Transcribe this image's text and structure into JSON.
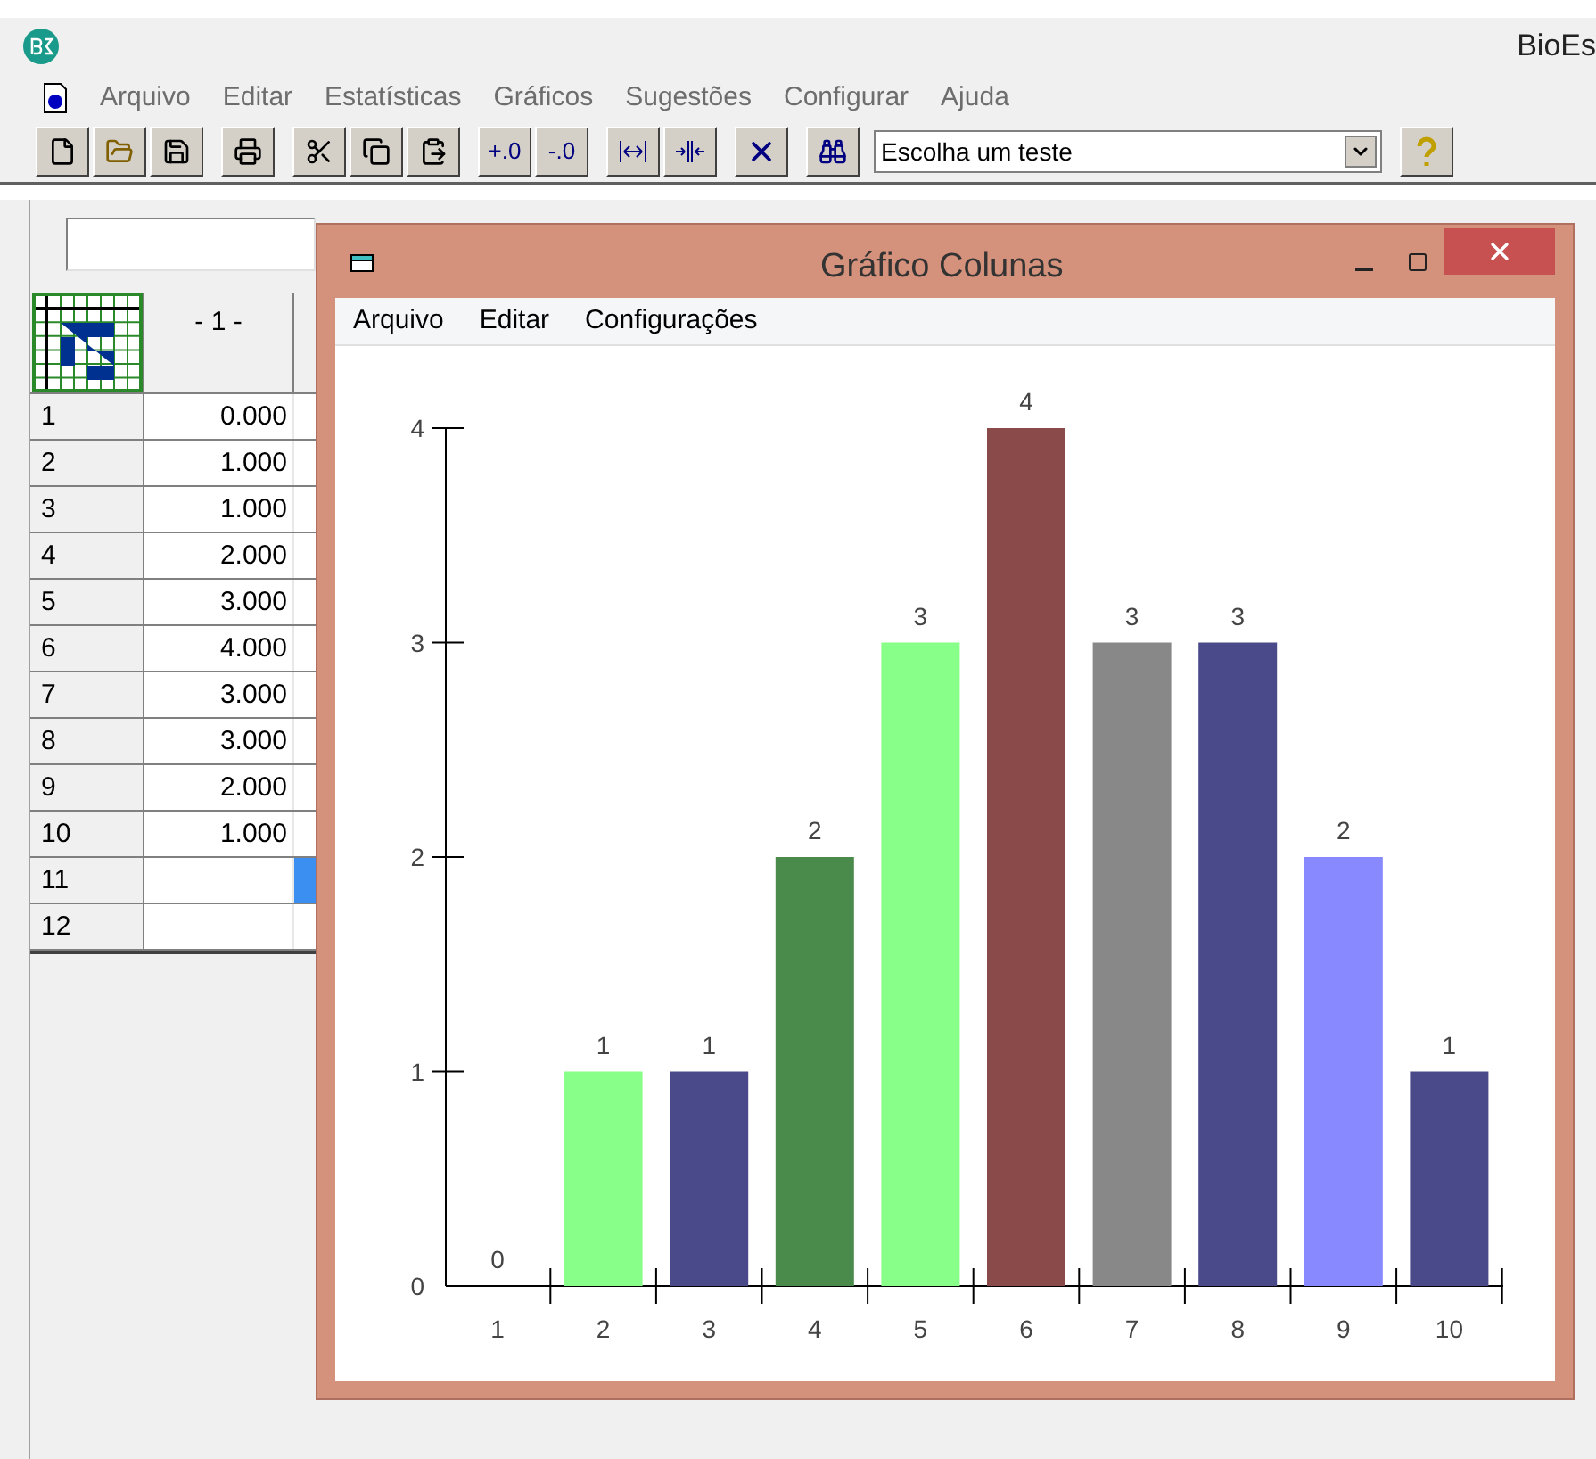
{
  "window": {
    "title": "BioEs"
  },
  "menu": [
    "Arquivo",
    "Editar",
    "Estatísticas",
    "Gráficos",
    "Sugestões",
    "Configurar",
    "Ajuda"
  ],
  "toolbar": {
    "test_select": {
      "value": "Escolha um teste"
    },
    "decimal_buttons": [
      "+.0",
      "-.0"
    ]
  },
  "grid": {
    "column_1": "- 1 -",
    "rows": [
      {
        "label": "1",
        "value": "0.000",
        "selected": false
      },
      {
        "label": "2",
        "value": "1.000",
        "selected": false
      },
      {
        "label": "3",
        "value": "1.000",
        "selected": false
      },
      {
        "label": "4",
        "value": "2.000",
        "selected": false
      },
      {
        "label": "5",
        "value": "3.000",
        "selected": false
      },
      {
        "label": "6",
        "value": "4.000",
        "selected": false
      },
      {
        "label": "7",
        "value": "3.000",
        "selected": false
      },
      {
        "label": "8",
        "value": "3.000",
        "selected": false
      },
      {
        "label": "9",
        "value": "2.000",
        "selected": false
      },
      {
        "label": "10",
        "value": "1.000",
        "selected": false
      },
      {
        "label": "11",
        "value": "",
        "selected": true
      },
      {
        "label": "12",
        "value": "",
        "selected": false
      }
    ]
  },
  "chart_window": {
    "title": "Gráfico Colunas",
    "menu": [
      "Arquivo",
      "Editar",
      "Configurações"
    ],
    "chart_data": {
      "type": "bar",
      "categories": [
        "1",
        "2",
        "3",
        "4",
        "5",
        "6",
        "7",
        "8",
        "9",
        "10"
      ],
      "ylim": [
        0,
        4
      ],
      "yticks": [
        0,
        1,
        2,
        3,
        4
      ],
      "data_labels": true,
      "series": [
        {
          "values": [
            0,
            1,
            1,
            2,
            3,
            4,
            3,
            3,
            2,
            1
          ],
          "colors": [
            null,
            "#88ff88",
            "#4a4a8a",
            "#4a8a4a",
            "#88ff88",
            "#8a4a4a",
            "#888888",
            "#4a4a8a",
            "#8888ff",
            "#4a4a8a"
          ]
        }
      ]
    }
  }
}
